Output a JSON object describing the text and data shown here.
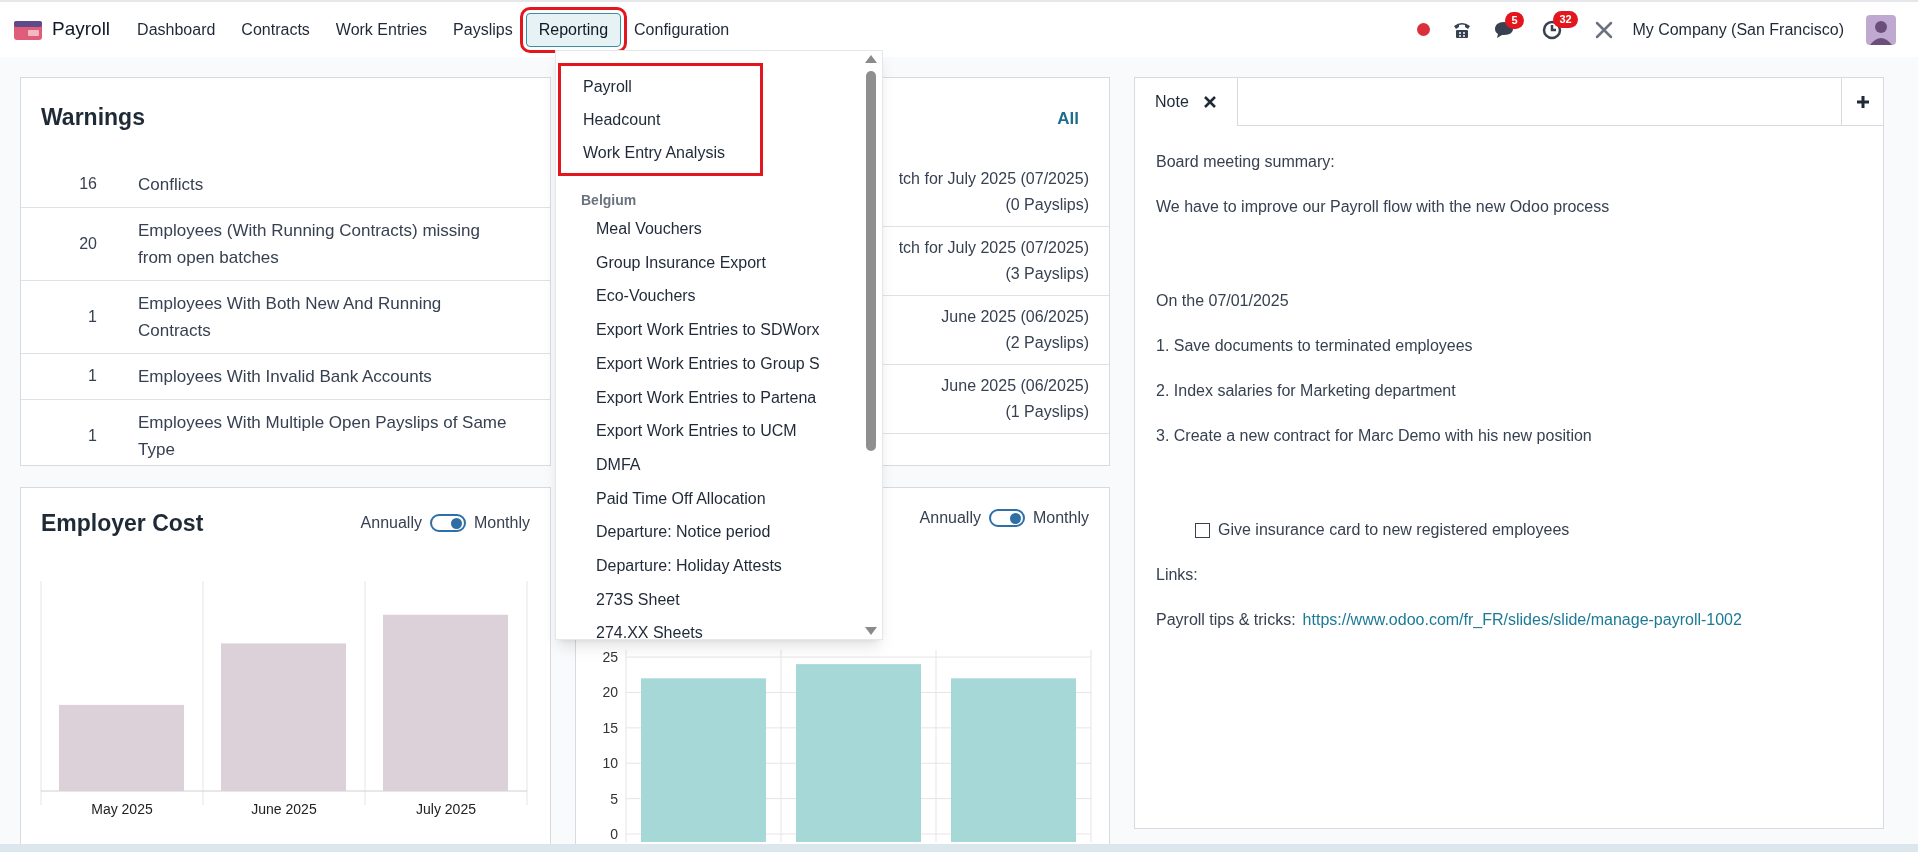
{
  "navbar": {
    "app_name": "Payroll",
    "menu": [
      {
        "label": "Dashboard",
        "selected": false
      },
      {
        "label": "Contracts",
        "selected": false
      },
      {
        "label": "Work Entries",
        "selected": false
      },
      {
        "label": "Payslips",
        "selected": false
      },
      {
        "label": "Reporting",
        "selected": true
      },
      {
        "label": "Configuration",
        "selected": false
      }
    ],
    "messages_badge": "5",
    "activities_badge": "32",
    "company": "My Company (San Francisco)"
  },
  "reporting_menu": {
    "items": [
      {
        "label": "Payroll"
      },
      {
        "label": "Headcount"
      },
      {
        "label": "Work Entry Analysis"
      }
    ],
    "groups": [
      {
        "label": "Belgium",
        "children": [
          {
            "label": "Meal Vouchers"
          },
          {
            "label": "Group Insurance Export"
          },
          {
            "label": "Eco-Vouchers"
          },
          {
            "label": "Export Work Entries to SDWorx"
          },
          {
            "label": "Export Work Entries to Group S"
          },
          {
            "label": "Export Work Entries to Partena"
          },
          {
            "label": "Export Work Entries to UCM"
          },
          {
            "label": "DMFA"
          },
          {
            "label": "Paid Time Off Allocation"
          },
          {
            "label": "Departure: Notice period"
          },
          {
            "label": "Departure: Holiday Attests"
          },
          {
            "label": "273S Sheet"
          },
          {
            "label": "274.XX Sheets"
          }
        ]
      }
    ]
  },
  "warnings": {
    "title": "Warnings",
    "rows": [
      {
        "count": "16",
        "label": "Conflicts"
      },
      {
        "count": "20",
        "label": "Employees (With Running Contracts) missing from open batches"
      },
      {
        "count": "1",
        "label": "Employees With Both New And Running Contracts"
      },
      {
        "count": "1",
        "label": "Employees With Invalid Bank Accounts"
      },
      {
        "count": "1",
        "label": "Employees With Multiple Open Payslips of Same Type"
      }
    ]
  },
  "batches": {
    "link": "All",
    "rows": [
      {
        "name": "tch for July 2025 (07/2025)",
        "payslips": "(0 Payslips)"
      },
      {
        "name": "tch for July 2025 (07/2025)",
        "payslips": "(3 Payslips)"
      },
      {
        "name": "June 2025 (06/2025)",
        "payslips": "(2 Payslips)"
      },
      {
        "name": "June 2025 (06/2025)",
        "payslips": "(1 Payslips)"
      }
    ]
  },
  "employer_cost": {
    "title": "Employer Cost",
    "toggle": {
      "left": "Annually",
      "right": "Monthly",
      "on": true
    },
    "labels": [
      "May 2025",
      "June 2025",
      "July 2025"
    ]
  },
  "second_chart": {
    "toggle": {
      "left": "Annually",
      "right": "Monthly",
      "on": true
    },
    "chart_data": {
      "type": "bar",
      "grid": true,
      "ylim": [
        0,
        26
      ],
      "yticks": [
        0,
        5,
        10,
        15,
        20,
        25
      ],
      "series": [
        {
          "color": "#a6d8d8",
          "values": [
            22,
            24,
            22
          ]
        }
      ]
    }
  },
  "note": {
    "tab": "Note",
    "paragraphs": [
      {
        "kind": "text",
        "text": "Board meeting summary:"
      },
      {
        "kind": "text",
        "text": "We have to improve our Payroll flow with the new Odoo process"
      },
      {
        "kind": "blank"
      },
      {
        "kind": "text",
        "text": "On the 07/01/2025"
      },
      {
        "kind": "text",
        "text": "1. Save documents to terminated employees"
      },
      {
        "kind": "text",
        "text": "2. Index salaries for Marketing department"
      },
      {
        "kind": "text",
        "text": "3. Create a new contract for Marc Demo with his new position"
      },
      {
        "kind": "blank"
      },
      {
        "kind": "check",
        "text": "Give insurance card to new registered employees",
        "checked": false
      },
      {
        "kind": "text",
        "text": "Links:"
      },
      {
        "kind": "link",
        "text": "Payroll tips & tricks:",
        "url": "https://www.odoo.com/fr_FR/slides/slide/manage-payroll-1002"
      }
    ]
  }
}
